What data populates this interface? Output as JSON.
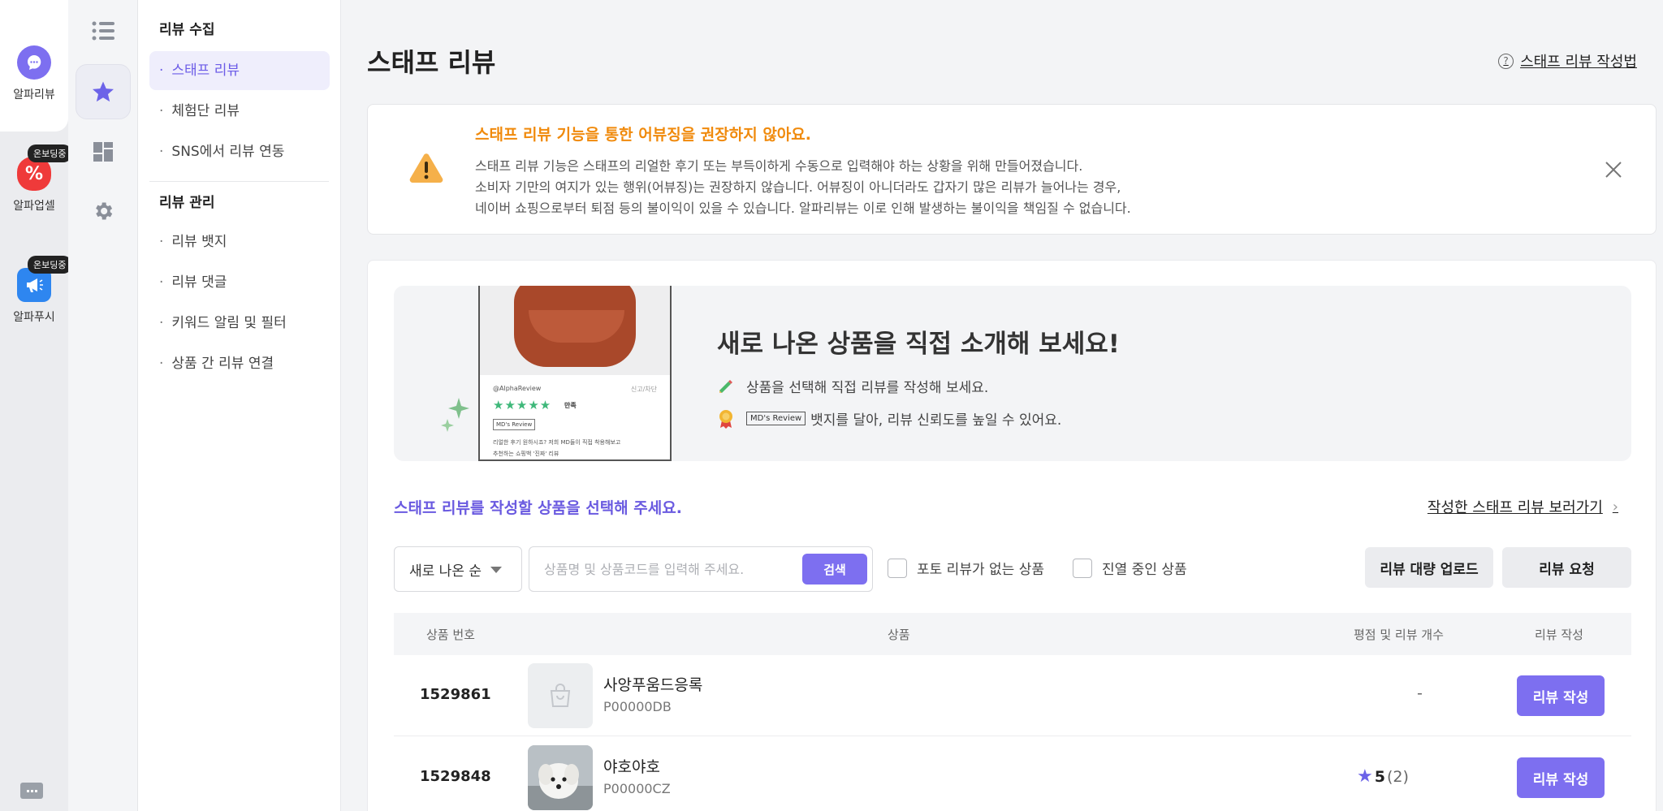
{
  "apps": [
    {
      "label": "알파리뷰",
      "icon": "chat-bubble-icon",
      "badge": ""
    },
    {
      "label": "알파업셀",
      "icon": "percent-tag-icon",
      "badge": "온보딩중"
    },
    {
      "label": "알파푸시",
      "icon": "megaphone-icon",
      "badge": "온보딩중"
    }
  ],
  "menu": {
    "section1": "리뷰 수집",
    "section1_items": [
      "스태프 리뷰",
      "체험단 리뷰",
      "SNS에서 리뷰 연동"
    ],
    "section2": "리뷰 관리",
    "section2_items": [
      "리뷰 뱃지",
      "리뷰 댓글",
      "키워드 알림 및 필터",
      "상품 간 리뷰 연결"
    ]
  },
  "page": {
    "title": "스태프 리뷰",
    "help_icon": "?",
    "help_link": "스태프 리뷰 작성법"
  },
  "warning": {
    "title": "스태프 리뷰 기능을 통한 어뷰징을 권장하지 않아요.",
    "line1": "스태프 리뷰 기능은 스태프의 리얼한 후기 또는 부득이하게 수동으로 입력해야 하는 상황을 위해 만들어졌습니다.",
    "line2": "소비자 기만의 여지가 있는 행위(어뷰징)는 권장하지 않습니다. 어뷰징이 아니더라도 갑자기 많은 리뷰가 늘어나는 경우,",
    "line3": "네이버 쇼핑으로부터 퇴점 등의 불이익이 있을 수 있습니다. 알파리뷰는 이로 인해 발생하는 불이익을 책임질 수 없습니다."
  },
  "banner": {
    "phone_user": "@AlphaReview",
    "phone_report": "신고/차단",
    "phone_stars": "★★★★★",
    "phone_rating": "만족",
    "phone_badge": "MD's Review",
    "phone_text1": "리얼한 후기 원하시죠? 저희 MD들이 직접 착용해보고",
    "phone_text2": "추천하는 쇼핑백 '진짜' 리뷰",
    "title": "새로 나온 상품을 직접 소개해 보세요!",
    "line1": "상품을 선택해 직접 리뷰를 작성해 보세요.",
    "line2_badge": "MD's Review",
    "line2": "뱃지를 달아, 리뷰 신뢰도를 높일 수 있어요."
  },
  "list": {
    "prompt": "스태프 리뷰를 작성할 상품을 선택해 주세요.",
    "view_link": "작성한 스태프 리뷰 보러가기",
    "view_chevron": "›",
    "sort_value": "새로 나온 순",
    "search_placeholder": "상품명 및 상품코드를 입력해 주세요.",
    "search_button": "검색",
    "filter_no_photo": "포토 리뷰가 없는 상품",
    "filter_on_display": "진열 중인 상품",
    "bulk_upload": "리뷰 대량 업로드",
    "review_request": "리뷰 요청",
    "columns": [
      "상품 번호",
      "상품",
      "평점 및 리뷰 개수",
      "리뷰 작성"
    ],
    "rows": [
      {
        "no": "1529861",
        "name": "사앙푸움드응록",
        "code": "P00000DB",
        "rating": "-",
        "score": "",
        "count": "",
        "write": "리뷰 작성"
      },
      {
        "no": "1529848",
        "name": "야호야호",
        "code": "P00000CZ",
        "rating": "",
        "score": "5",
        "count": "(2)",
        "write": "리뷰 작성"
      }
    ]
  },
  "colors": {
    "accent": "#7d6ff0",
    "warning": "#f08a0c",
    "star": "#6c63e8"
  }
}
